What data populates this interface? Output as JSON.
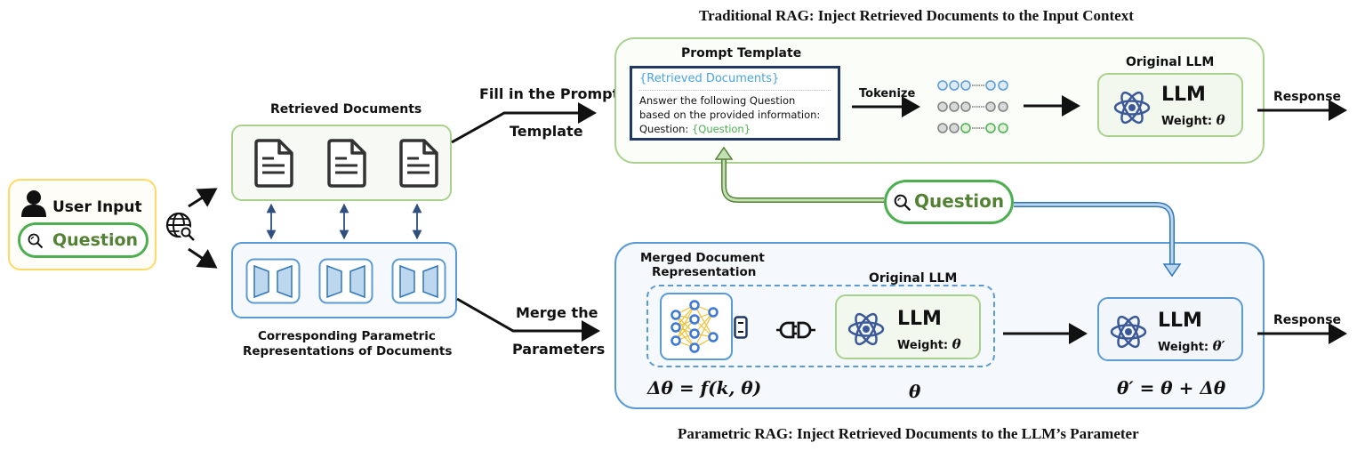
{
  "titles": {
    "traditional": "Traditional RAG: Inject Retrieved Documents to the Input Context",
    "parametric": "Parametric RAG: Inject Retrieved Documents to the LLM’s Parameter"
  },
  "user_input": {
    "label": "User Input",
    "question": "Question",
    "icons": [
      "user-icon",
      "search-icon",
      "globe-search-icon"
    ]
  },
  "retrieved_documents": {
    "label": "Retrieved Documents",
    "count": 3,
    "icon": "document-icon"
  },
  "parametric_representations": {
    "label_line1": "Corresponding Parametric",
    "label_line2": "Representations of Documents",
    "count": 3,
    "icon": "lora-adapter-icon"
  },
  "flows": {
    "fill_line1": "Fill in the Prompt",
    "fill_line2": "Template",
    "merge_line1": "Merge the",
    "merge_line2": "Parameters",
    "tokenize": "Tokenize",
    "response_top": "Response",
    "response_bottom": "Response"
  },
  "prompt_template": {
    "heading": "Prompt Template",
    "retrieved_placeholder": "{Retrieved Documents}",
    "line1": "Answer the following Question",
    "line2": "based on the provided information:",
    "question_prefix": "Question: ",
    "question_placeholder": "{Question}"
  },
  "tokens": {
    "rows": [
      [
        "blue",
        "blue",
        "blue",
        "blue",
        "blue"
      ],
      [
        "gray",
        "gray",
        "gray",
        "gray",
        "gray"
      ],
      [
        "gray",
        "gray",
        "green",
        "green",
        "green"
      ]
    ]
  },
  "original_llm_top": {
    "heading": "Original LLM",
    "title": "LLM",
    "weight_label": "Weight: ",
    "weight_symbol": "θ"
  },
  "question_pill": {
    "label": "Question"
  },
  "parametric_section": {
    "merged_heading_line1": "Merged Document",
    "merged_heading_line2": "Representation",
    "original_heading": "Original LLM",
    "llm_title": "LLM",
    "weight_label": "Weight: ",
    "weight_symbol": "θ",
    "delta_formula": "Δθ = f(k, θ)",
    "theta_label": "θ",
    "updated_llm_title": "LLM",
    "updated_weight_label": "Weight: ",
    "updated_weight_symbol": "θ′",
    "update_formula": "θ′ = θ + Δθ"
  },
  "colors": {
    "green_border": "#a9d18e",
    "green_fill": "#f3f8ee",
    "green_text": "#548235",
    "green_pill": "#4caf50",
    "blue_border": "#5b9bd5",
    "blue_fill": "#f5f8fc",
    "blue_text": "#4aa3df",
    "yellow_border": "#ffd966",
    "yellow_fill": "#fffdf7",
    "navy": "#1f3864",
    "atom": "#3b5998",
    "nn_node": "#3c78d8",
    "nn_edge": "#f1c232"
  }
}
